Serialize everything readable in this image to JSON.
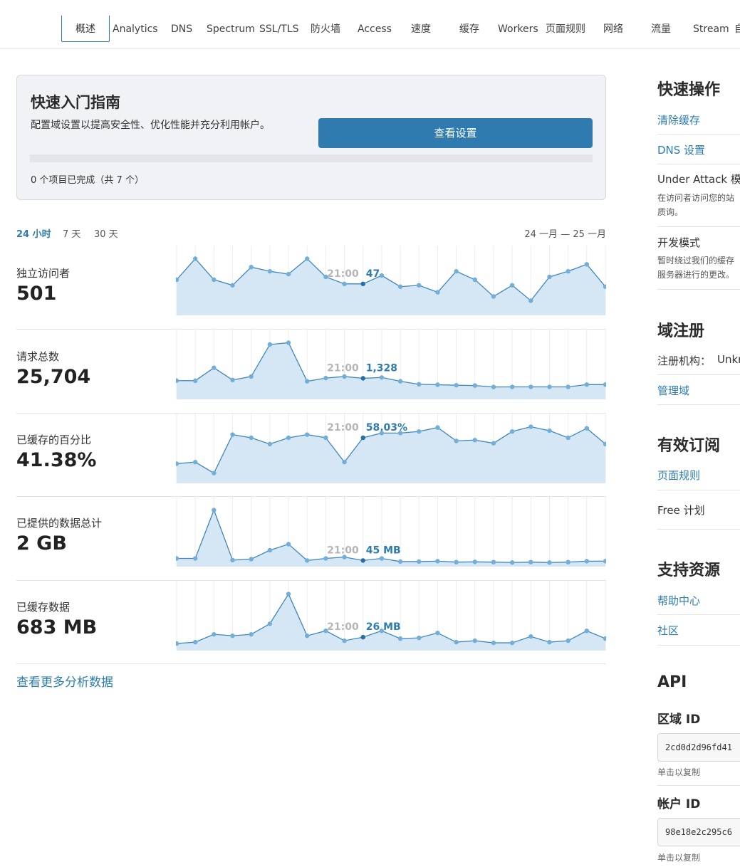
{
  "nav": {
    "tabs": [
      "概述",
      "Analytics",
      "DNS",
      "Spectrum",
      "SSL/TLS",
      "防火墙",
      "Access",
      "速度",
      "缓存",
      "Workers",
      "页面规则",
      "网络",
      "流量",
      "Stream",
      "自"
    ]
  },
  "quickstart": {
    "title": "快速入门指南",
    "description": "配置域设置以提高安全性、优化性能并充分利用帐户。",
    "button": "查看设置",
    "status": "0 个项目已完成（共 7 个）",
    "progress": 0
  },
  "range": {
    "options": [
      "24 小时",
      "7 天",
      "30 天"
    ],
    "selected": "24 小时",
    "dates": "24 一月 — 25 一月"
  },
  "metrics": [
    {
      "label": "独立访问者",
      "value": "501",
      "hover_time": "21:00",
      "hover_value": "47",
      "hover_index": 10
    },
    {
      "label": "请求总数",
      "value": "25,704",
      "hover_time": "21:00",
      "hover_value": "1,328",
      "hover_index": 10
    },
    {
      "label": "已缓存的百分比",
      "value": "41.38%",
      "hover_time": "21:00",
      "hover_value": "58.03%",
      "hover_index": 10
    },
    {
      "label": "已提供的数据总计",
      "value": "2 GB",
      "hover_time": "21:00",
      "hover_value": "45 MB",
      "hover_index": 10
    },
    {
      "label": "已缓存数据",
      "value": "683 MB",
      "hover_time": "21:00",
      "hover_value": "26 MB",
      "hover_index": 10
    }
  ],
  "chart_data": [
    {
      "type": "area",
      "title": "独立访问者",
      "x": [
        0,
        1,
        2,
        3,
        4,
        5,
        6,
        7,
        8,
        9,
        10,
        11,
        12,
        13,
        14,
        15,
        16,
        17,
        18,
        19,
        20,
        21,
        22,
        23
      ],
      "values": [
        50,
        65,
        50,
        46,
        59,
        56,
        54,
        65,
        52,
        47,
        47,
        53,
        45,
        46,
        41,
        56,
        50,
        38,
        46,
        35,
        52,
        56,
        61,
        45
      ]
    },
    {
      "type": "area",
      "title": "请求总数",
      "x": [
        0,
        1,
        2,
        3,
        4,
        5,
        6,
        7,
        8,
        9,
        10,
        11,
        12,
        13,
        14,
        15,
        16,
        17,
        18,
        19,
        20,
        21,
        22,
        23
      ],
      "values": [
        1180,
        1175,
        1990,
        1220,
        1440,
        3460,
        3570,
        1140,
        1340,
        1440,
        1328,
        1380,
        1140,
        950,
        920,
        890,
        870,
        780,
        785,
        785,
        785,
        785,
        930,
        930
      ]
    },
    {
      "type": "area",
      "title": "已缓存的百分比",
      "x": [
        0,
        1,
        2,
        3,
        4,
        5,
        6,
        7,
        8,
        9,
        10,
        11,
        12,
        13,
        14,
        15,
        16,
        17,
        18,
        19,
        20,
        21,
        22,
        23
      ],
      "values": [
        25,
        27,
        13,
        62,
        58,
        50,
        58,
        62,
        58,
        27,
        58.03,
        64,
        64,
        66,
        71,
        54,
        55,
        51,
        66,
        72,
        67,
        58,
        70,
        50
      ]
    },
    {
      "type": "area",
      "title": "已提供的数据总计",
      "x": [
        0,
        1,
        2,
        3,
        4,
        5,
        6,
        7,
        8,
        9,
        10,
        11,
        12,
        13,
        14,
        15,
        16,
        17,
        18,
        19,
        20,
        21,
        22,
        23
      ],
      "values": [
        60,
        60,
        415,
        48,
        55,
        120,
        165,
        45,
        60,
        70,
        45,
        60,
        37,
        37,
        40,
        33,
        35,
        33,
        30,
        33,
        30,
        33,
        40,
        40
      ]
    },
    {
      "type": "area",
      "title": "已缓存数据",
      "x": [
        0,
        1,
        2,
        3,
        4,
        5,
        6,
        7,
        8,
        9,
        10,
        11,
        12,
        13,
        14,
        15,
        16,
        17,
        18,
        19,
        20,
        21,
        22,
        23
      ],
      "values": [
        10,
        12,
        23,
        21,
        23,
        38,
        80,
        21,
        28,
        14,
        19,
        28,
        17,
        18,
        25,
        12,
        14,
        11,
        11,
        20,
        12,
        14,
        28,
        17
      ]
    }
  ],
  "more_link": "查看更多分析数据",
  "sidebar": {
    "quick_actions": {
      "title": "快速操作",
      "purge": "清除缓存",
      "dns": "DNS 设置",
      "under_attack": "Under Attack 模",
      "under_attack_desc1": "在访问者访问您的站",
      "under_attack_desc2": "质询。",
      "dev_mode": "开发模式",
      "dev_mode_desc1": "暂时绕过我们的缓存",
      "dev_mode_desc2": "服务器进行的更改。"
    },
    "domain_registration": {
      "title": "域注册",
      "registrar_label": "注册机构：",
      "registrar_value": "Unkn",
      "manage": "管理域"
    },
    "subscriptions": {
      "title": "有效订阅",
      "page_rules": "页面规则",
      "plan": "Free 计划"
    },
    "support": {
      "title": "支持资源",
      "help": "帮助中心",
      "community": "社区"
    },
    "api": {
      "title": "API",
      "zone_label": "区域 ID",
      "zone_id": "2cd0d2d96fd41",
      "zone_hint": "单击以复制",
      "account_label": "帐户 ID",
      "account_id": "98e18e2c295c6",
      "account_hint": "单击以复制"
    }
  }
}
